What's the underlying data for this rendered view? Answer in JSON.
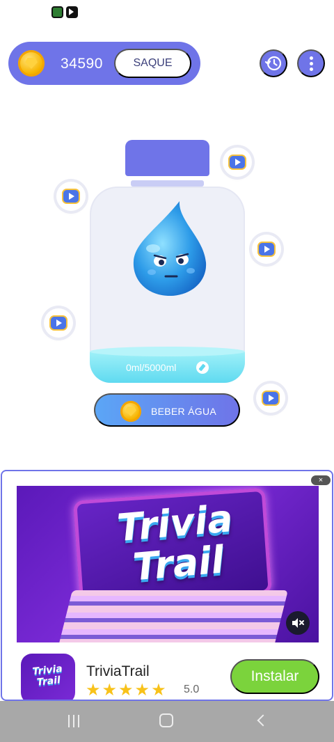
{
  "header": {
    "coin_balance": "34590",
    "withdraw_label": "SAQUE"
  },
  "bottle": {
    "water_amount": "0ml/5000ml"
  },
  "actions": {
    "drink_label": "BEBER ÁGUA"
  },
  "ad": {
    "banner_title_line1": "Trivia",
    "banner_title_line2": "Trail",
    "app_icon_text": "Trivia Trail",
    "app_name": "TriviaTrail",
    "rating": "5.0",
    "rating_stars": 5,
    "install_label": "Instalar",
    "close_label": "×"
  },
  "colors": {
    "accent": "#6f74e8",
    "water": "#5fdaf0",
    "install": "#7bd33c",
    "star": "#f8c21a"
  }
}
